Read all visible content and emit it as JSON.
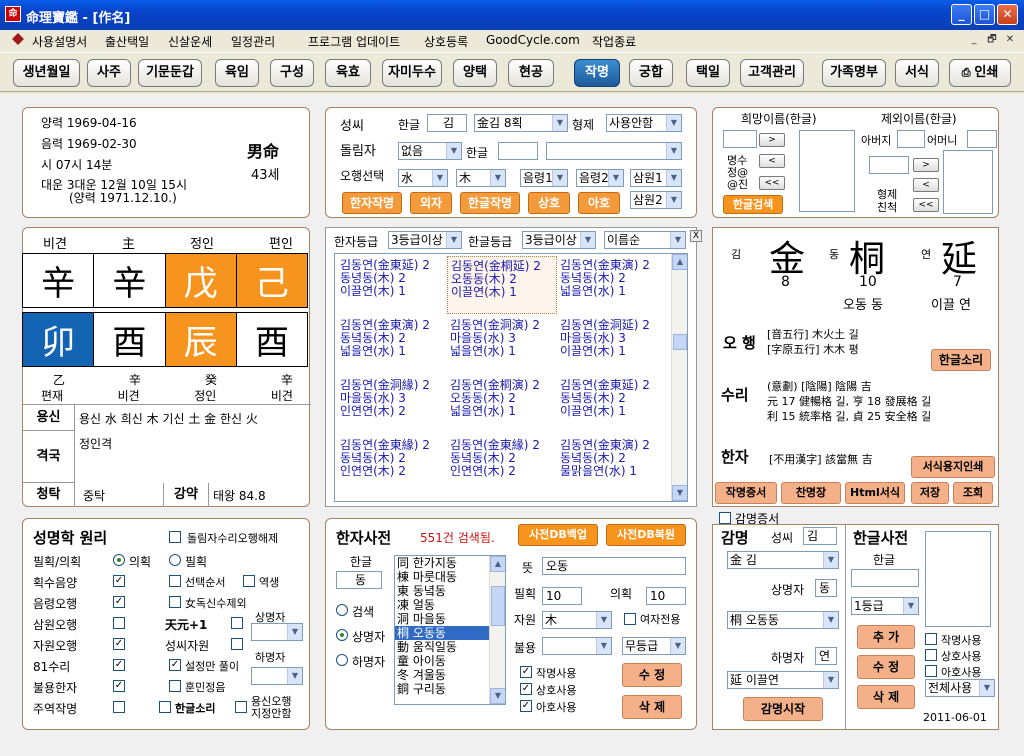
{
  "window": {
    "title": "命理寶鑑  - [作名]",
    "app_icon": "app-icon",
    "min": "_",
    "max": "□",
    "close": "✕"
  },
  "menu": [
    "사용설명서",
    "출산택일",
    "신살운세",
    "일정관리",
    "프로그램 업데이트",
    "상호등록",
    "GoodCycle.com",
    "작업종료"
  ],
  "mdi": [
    "_",
    "🗗",
    "✕"
  ],
  "toolbar": [
    "생년월일",
    "사주",
    "기문둔갑",
    "육임",
    "구성",
    "육효",
    "자미두수",
    "양택",
    "현공",
    "작명",
    "궁합",
    "택일",
    "고객관리",
    "가족명부",
    "서식",
    "인쇄"
  ],
  "birth": {
    "yang": "양력 1969-04-16",
    "eum": "음력 1969-02-30",
    "time": "시  07시 14분",
    "daeun": "대운  3대운 12월 10일 15시",
    "daeun2": "(양력 1971.12.10.)",
    "gender": "男命",
    "age": "43세"
  },
  "saju": {
    "top_labels": [
      "비견",
      "主",
      "정인",
      "편인"
    ],
    "heaven": [
      "辛",
      "辛",
      "戊",
      "己"
    ],
    "earth": [
      "卯",
      "酉",
      "辰",
      "酉"
    ],
    "hidden": [
      "乙",
      "辛",
      "癸",
      "辛"
    ],
    "bottom_labels": [
      "편재",
      "비견",
      "정인",
      "비견"
    ],
    "yongsin_label": "용신",
    "yongsin": "용신 水 희신 木  기신 土 金 한신 火",
    "gyeok_label": "격국",
    "gyeok": "정인격",
    "cheongtak_label": "청탁",
    "cheongtak": "중탁",
    "gangyak_label": "강약",
    "gangyak": "태왕  84.8"
  },
  "surname": {
    "seongssi": "성씨",
    "hangul": "한글",
    "hangul_val": "김",
    "hanja_sel": "金김 8획",
    "hyeongje": "형제",
    "hyeongje_sel": "사용안함",
    "dollimja": "돌림자",
    "dollim_sel": "없음",
    "dollim_hangul": "한글",
    "ohaeng": "오행선택",
    "oh1": "水",
    "oh2": "木",
    "eum1": "음령1",
    "eum2": "음령2",
    "sam1": "삼원1",
    "sam2": "삼원2",
    "btns": [
      "한자작명",
      "외자",
      "한글작명",
      "상호",
      "아호"
    ]
  },
  "hope": {
    "title1": "희망이름(한글)",
    "title2": "제외이름(한글)",
    "father": "아버지",
    "mother": "어머니",
    "ms": "명수",
    "jeong": "정@",
    "jin": "@진",
    "hyeongje": "형제",
    "chincheok": "친척",
    "search_btn": "한글검색",
    "next": ">",
    "prev": "<",
    "all": "<<"
  },
  "filter": {
    "hanja": "한자등급",
    "hanja_sel": "3등급이상",
    "hangul": "한글등급",
    "hangul_sel": "3등급이상",
    "order_sel": "이름순",
    "close": "X"
  },
  "candidates": [
    [
      "김동연(金東延) 2",
      "동녕동(木) 2",
      "이끌연(木) 1"
    ],
    [
      "김동연(金桐延) 2",
      "오동동(木) 2",
      "이끌연(木) 1"
    ],
    [
      "김동연(金東演) 2",
      "동녘동(木) 2",
      "넓을연(水) 1"
    ],
    [
      "김동연(金東演) 2",
      "동녘동(木) 2",
      "넓을연(水) 1"
    ],
    [
      "김동연(金洞演) 2",
      "마을동(水) 3",
      "넓을연(水) 1"
    ],
    [
      "김동연(金洞延) 2",
      "마을동(水) 3",
      "이끌연(木) 1"
    ],
    [
      "김동연(金洞緣) 2",
      "마을동(水) 3",
      "인연연(木) 2"
    ],
    [
      "김동연(金桐演) 2",
      "오동동(木) 2",
      "넓을연(水) 1"
    ],
    [
      "김동연(金東延) 2",
      "동녘동(木) 2",
      "이끌연(木) 1"
    ],
    [
      "김동연(金東緣) 2",
      "동녘동(木) 2",
      "인연연(木) 2"
    ],
    [
      "김동연(金東緣) 2",
      "동녘동(木) 2",
      "인연연(木) 2"
    ],
    [
      "김동연(金東演) 2",
      "동녘동(木) 2",
      "물맑을연(水) 1"
    ]
  ],
  "name_display": {
    "k1": "김",
    "h1": "金",
    "n1": "8",
    "k2": "동",
    "h2": "桐",
    "n2": "10",
    "m2": "오동 동",
    "k3": "연",
    "h3": "延",
    "n3": "7",
    "m3": "이끌 연",
    "ohaeng_label": "오 행",
    "ohaeng1": "[音五行] 木火土 길",
    "ohaeng2": "[字原五行] 木木 평",
    "hangul_sound": "한글소리",
    "suri_label": "수리",
    "suri1": "(意劃) [陰陽] 陰陽 吉",
    "suri2": "元 17 健暢格 길, 亨 18 發展格 길",
    "suri3": "利 15 統率格 길, 貞 25 安全格 길",
    "hanja_label": "한자",
    "hanja_note": "[不用漢字] 該當無 吉",
    "print_btn": "서식용지인쇄",
    "btns": [
      "작명증서",
      "찬명장",
      "Html서식",
      "저장",
      "조회"
    ]
  },
  "principle": {
    "title": "성명학 원리",
    "dollim": "돌림자수리오행해제",
    "pilhoek_label": "필획/의획",
    "uihoek": "의획",
    "pilhoek": "필획",
    "rows": [
      "획수음양",
      "음령오행",
      "삼원오행",
      "자원오행",
      "81수리",
      "불용한자",
      "주역작명"
    ],
    "opt_seontaek": "선택순서",
    "opt_yeoksaeng": "역생",
    "opt_nyeo": "女독신수제외",
    "opt_cheonwon": "天元+1",
    "opt_seongssi": "성씨자원",
    "opt_seoljeong": "설정만 풀이",
    "opt_hunmin": "훈민정음",
    "opt_hangul_sori": "한글소리",
    "opt_yongsin": "용신오행",
    "opt_jijeong": "지정안함",
    "sang": "상명자",
    "ha": "하명자"
  },
  "dict": {
    "title": "한자사전",
    "count": "551건 검색됨.",
    "backup": "사전DB백업",
    "restore": "사전DB복원",
    "hangul": "한글",
    "hangul_val": "동",
    "search": "검색",
    "sang": "상명자",
    "ha": "하명자",
    "list": [
      "同 한가지동",
      "棟 마룻대동",
      "東 동녘동",
      "凍 얼동",
      "洞 마을동",
      "桐 오동동",
      "動 움직일동",
      "童 아이동",
      "冬 겨울동",
      "銅 구리동"
    ],
    "meaning_label": "뜻",
    "meaning": "오동",
    "pil": "필획",
    "pil_val": "10",
    "ui": "의획",
    "ui_val": "10",
    "jawon": "자원",
    "jawon_sel": "木",
    "female": "여자전용",
    "bulyong": "불용",
    "grade_sel": "무등급",
    "use1": "작명사용",
    "use2": "상호사용",
    "use3": "아호사용",
    "edit": "수 정",
    "delete": "삭 제"
  },
  "gammyeong": {
    "cert": "감명증서",
    "title": "감명",
    "seongssi": "성씨",
    "seongssi_val": "김",
    "sel1": "金 김",
    "sang": "상명자",
    "sang_val": "동",
    "sel2": "桐 오동동",
    "ha": "하명자",
    "ha_val": "연",
    "sel3": "延 이끌연",
    "start": "감명시작"
  },
  "hangul_dict": {
    "title": "한글사전",
    "hangul": "한글",
    "grade_sel": "1등급",
    "add": "추 가",
    "edit": "수 정",
    "delete": "삭 제",
    "u1": "작명사용",
    "u2": "상호사용",
    "u3": "아호사용",
    "all_sel": "전체사용",
    "date": "2011-06-01"
  }
}
